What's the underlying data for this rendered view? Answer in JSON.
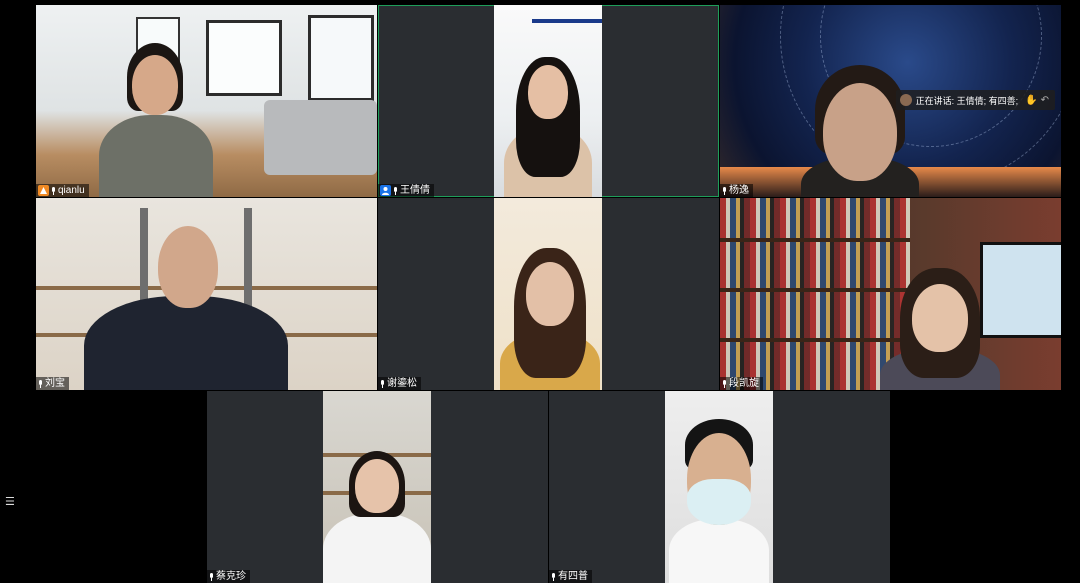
{
  "meeting": {
    "speaking_prefix": "正在讲话: 王倩倩; 有四善;",
    "participants": [
      {
        "name": "qianlu",
        "role": "host"
      },
      {
        "name": "王倩倩",
        "role": "cohost",
        "active_speaker": true
      },
      {
        "name": "杨逸"
      },
      {
        "name": "刘宝"
      },
      {
        "name": "谢鎏松"
      },
      {
        "name": "段凯旋"
      },
      {
        "name": "蔡克珍"
      },
      {
        "name": "有四普"
      }
    ]
  },
  "icons": {
    "mic": "microphone-icon",
    "host": "host-badge-icon",
    "list": "participant-list-icon"
  },
  "colors": {
    "tile_bg": "#2a2d31",
    "active_border": "#1e9e5a",
    "host_orange": "#f08a24",
    "cohost_blue": "#1a73e8"
  }
}
